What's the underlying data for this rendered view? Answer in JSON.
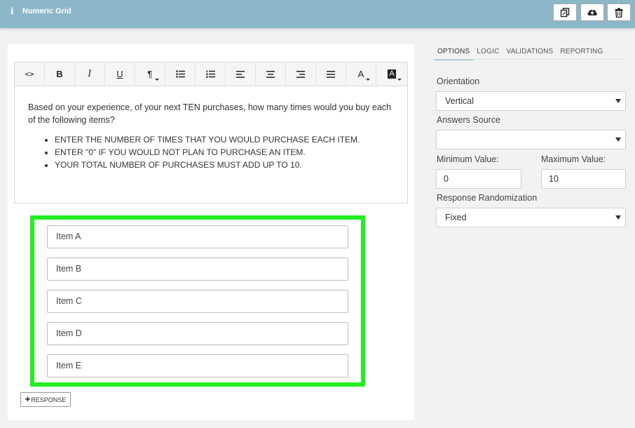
{
  "header": {
    "info_glyph": "i",
    "title": "Numeric Grid",
    "buttons": [
      {
        "name": "copy-button",
        "icon": "copy-icon"
      },
      {
        "name": "upload-button",
        "icon": "cloud-upload-icon"
      },
      {
        "name": "delete-button",
        "icon": "trash-icon"
      }
    ]
  },
  "toolbar": {
    "code": "<>",
    "bold": "B",
    "italic": "I",
    "underline": "U",
    "paragraph": "¶",
    "font_color": "A",
    "bg_color": "A"
  },
  "editor": {
    "question": "Based on your experience, of your next TEN purchases, how many times would you buy each of the following items?",
    "bullets": [
      "ENTER THE NUMBER OF TIMES THAT YOU WOULD PURCHASE EACH ITEM.",
      "ENTER \"0\" IF YOU WOULD NOT PLAN TO PURCHASE AN ITEM.",
      "YOUR TOTAL NUMBER OF PURCHASES MUST ADD UP TO 10."
    ]
  },
  "items": [
    "Item A",
    "Item B",
    "Item C",
    "Item D",
    "Item E"
  ],
  "response_button": {
    "plus": "✚",
    "label": "RESPONSE"
  },
  "tabs": [
    "OPTIONS",
    "LOGIC",
    "VALIDATIONS",
    "REPORTING"
  ],
  "options": {
    "orientation_label": "Orientation",
    "orientation_value": "Vertical",
    "answers_source_label": "Answers Source",
    "answers_source_value": "",
    "min_label": "Minimum Value:",
    "min_value": "0",
    "max_label": "Maximum Value:",
    "max_value": "10",
    "randomization_label": "Response Randomization",
    "randomization_value": "Fixed"
  },
  "colors": {
    "header": "#8cb7c9",
    "highlight": "#22ee22"
  }
}
